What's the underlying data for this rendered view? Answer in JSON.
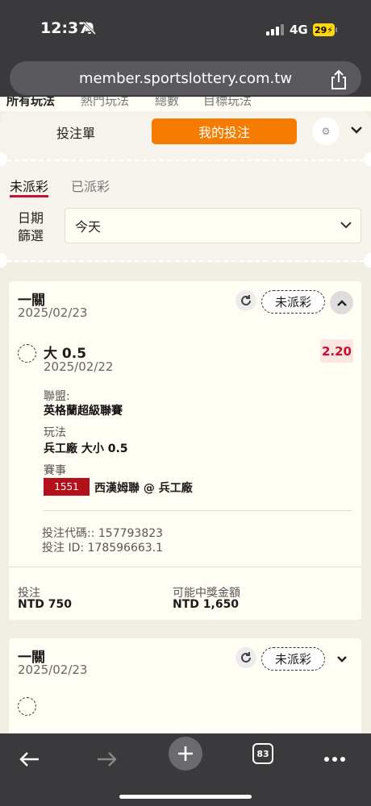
{
  "status_bar": {
    "time": "12:37",
    "network": "4G",
    "battery": "29"
  },
  "browser": {
    "url": "member.sportslottery.com.tw",
    "tabs_count": "83"
  },
  "market_tabs": [
    "所有玩法",
    "熱門玩法",
    "總數",
    "目標玩法"
  ],
  "slip_tabs": {
    "betslip": "投注單",
    "my_bets": "我的投注"
  },
  "settlement_tabs": {
    "unsettled": "未派彩",
    "settled": "已派彩"
  },
  "filter": {
    "label": "日期\n篩選",
    "value": "今天"
  },
  "bets": [
    {
      "type": "一關",
      "date": "2025/02/23",
      "status": "未派彩",
      "selection": "大 0.5",
      "selection_date": "2025/02/22",
      "odds": "2.20",
      "league_label": "聯盟:",
      "league": "英格蘭超級聯賽",
      "market_label": "玩法",
      "market": "兵工廠 大小 0.5",
      "event_label": "賽事",
      "event_id": "1551",
      "event": "西漢姆聯 @ 兵工廠",
      "bet_code": "投注代碼:: 157793823",
      "bet_id": "投注 ID: 178596663.1",
      "stake_label": "投注",
      "stake": "NTD 750",
      "winnings_label": "可能中獎金額",
      "winnings": "NTD 1,650"
    },
    {
      "type": "一關",
      "date": "2025/02/23",
      "status": "未派彩"
    }
  ],
  "colors": {
    "accent": "#f57c00",
    "active_underline": "#c8102e",
    "odds": "#c8102e",
    "event_badge": "#b3101b"
  }
}
